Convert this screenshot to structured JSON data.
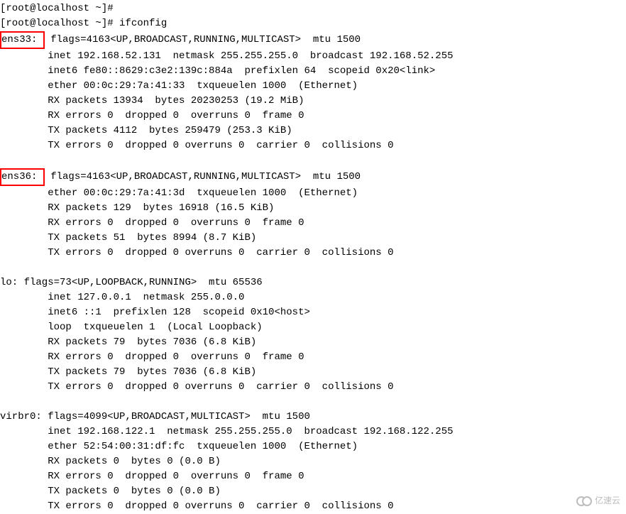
{
  "prompts": {
    "empty": "[root@localhost ~]# ",
    "cmd_line": "[root@localhost ~]# ifconfig"
  },
  "iface_ens33": {
    "name_boxed": "ens33: ",
    "line0_rest": " flags=4163<UP,BROADCAST,RUNNING,MULTICAST>  mtu 1500",
    "inet": "        inet 192.168.52.131  netmask 255.255.255.0  broadcast 192.168.52.255",
    "inet6": "        inet6 fe80::8629:c3e2:139c:884a  prefixlen 64  scopeid 0x20<link>",
    "ether": "        ether 00:0c:29:7a:41:33  txqueuelen 1000  (Ethernet)",
    "rxp": "        RX packets 13934  bytes 20230253 (19.2 MiB)",
    "rxe": "        RX errors 0  dropped 0  overruns 0  frame 0",
    "txp": "        TX packets 4112  bytes 259479 (253.3 KiB)",
    "txe": "        TX errors 0  dropped 0 overruns 0  carrier 0  collisions 0"
  },
  "iface_ens36": {
    "name_boxed": "ens36: ",
    "line0_rest": " flags=4163<UP,BROADCAST,RUNNING,MULTICAST>  mtu 1500",
    "ether": "        ether 00:0c:29:7a:41:3d  txqueuelen 1000  (Ethernet)",
    "rxp": "        RX packets 129  bytes 16918 (16.5 KiB)",
    "rxe": "        RX errors 0  dropped 0  overruns 0  frame 0",
    "txp": "        TX packets 51  bytes 8994 (8.7 KiB)",
    "txe": "        TX errors 0  dropped 0 overruns 0  carrier 0  collisions 0"
  },
  "iface_lo": {
    "line0": "lo: flags=73<UP,LOOPBACK,RUNNING>  mtu 65536",
    "inet": "        inet 127.0.0.1  netmask 255.0.0.0",
    "inet6": "        inet6 ::1  prefixlen 128  scopeid 0x10<host>",
    "loop": "        loop  txqueuelen 1  (Local Loopback)",
    "rxp": "        RX packets 79  bytes 7036 (6.8 KiB)",
    "rxe": "        RX errors 0  dropped 0  overruns 0  frame 0",
    "txp": "        TX packets 79  bytes 7036 (6.8 KiB)",
    "txe": "        TX errors 0  dropped 0 overruns 0  carrier 0  collisions 0"
  },
  "iface_virbr0": {
    "line0": "virbr0: flags=4099<UP,BROADCAST,MULTICAST>  mtu 1500",
    "inet": "        inet 192.168.122.1  netmask 255.255.255.0  broadcast 192.168.122.255",
    "ether": "        ether 52:54:00:31:df:fc  txqueuelen 1000  (Ethernet)",
    "rxp": "        RX packets 0  bytes 0 (0.0 B)",
    "rxe": "        RX errors 0  dropped 0  overruns 0  frame 0",
    "txp": "        TX packets 0  bytes 0 (0.0 B)",
    "txe": "        TX errors 0  dropped 0 overruns 0  carrier 0  collisions 0"
  },
  "watermark": {
    "text": "亿速云"
  }
}
